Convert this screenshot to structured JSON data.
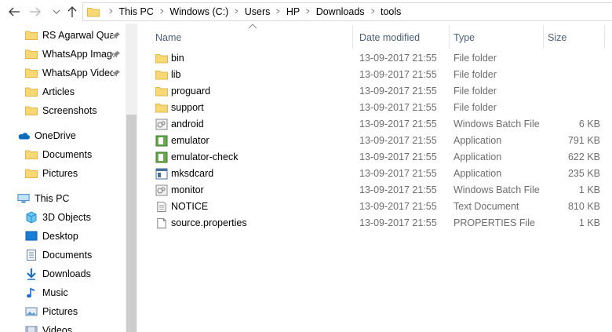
{
  "breadcrumb": [
    "This PC",
    "Windows (C:)",
    "Users",
    "HP",
    "Downloads",
    "tools"
  ],
  "sidebar": {
    "quick_access": [
      {
        "label": "RS Agarwal Quan",
        "pinned": true
      },
      {
        "label": "WhatsApp Image",
        "pinned": true
      },
      {
        "label": "WhatsApp Video",
        "pinned": true
      },
      {
        "label": "Articles",
        "pinned": false
      },
      {
        "label": "Screenshots",
        "pinned": false
      }
    ],
    "onedrive": {
      "label": "OneDrive",
      "items": [
        "Documents",
        "Pictures"
      ]
    },
    "this_pc": {
      "label": "This PC",
      "items": [
        "3D Objects",
        "Desktop",
        "Documents",
        "Downloads",
        "Music",
        "Pictures",
        "Videos"
      ]
    }
  },
  "columns": {
    "name": "Name",
    "date": "Date modified",
    "type": "Type",
    "size": "Size"
  },
  "files": [
    {
      "name": "bin",
      "date": "13-09-2017 21:55",
      "type": "File folder",
      "size": "",
      "icon": "folder-icon"
    },
    {
      "name": "lib",
      "date": "13-09-2017 21:55",
      "type": "File folder",
      "size": "",
      "icon": "folder-icon"
    },
    {
      "name": "proguard",
      "date": "13-09-2017 21:55",
      "type": "File folder",
      "size": "",
      "icon": "folder-icon"
    },
    {
      "name": "support",
      "date": "13-09-2017 21:55",
      "type": "File folder",
      "size": "",
      "icon": "folder-icon"
    },
    {
      "name": "android",
      "date": "13-09-2017 21:55",
      "type": "Windows Batch File",
      "size": "6 KB",
      "icon": "batch-file-icon"
    },
    {
      "name": "emulator",
      "date": "13-09-2017 21:55",
      "type": "Application",
      "size": "791 KB",
      "icon": "application-icon"
    },
    {
      "name": "emulator-check",
      "date": "13-09-2017 21:55",
      "type": "Application",
      "size": "622 KB",
      "icon": "application-icon"
    },
    {
      "name": "mksdcard",
      "date": "13-09-2017 21:55",
      "type": "Application",
      "size": "235 KB",
      "icon": "app-window-icon"
    },
    {
      "name": "monitor",
      "date": "13-09-2017 21:55",
      "type": "Windows Batch File",
      "size": "1 KB",
      "icon": "batch-file-icon"
    },
    {
      "name": "NOTICE",
      "date": "13-09-2017 21:55",
      "type": "Text Document",
      "size": "810 KB",
      "icon": "text-file-icon"
    },
    {
      "name": "source.properties",
      "date": "13-09-2017 21:55",
      "type": "PROPERTIES File",
      "size": "1 KB",
      "icon": "blank-file-icon"
    }
  ],
  "colors": {
    "folder": "#f8d775",
    "header_text": "#4c607a",
    "detail_text": "#6d6d6d",
    "onedrive": "#0f6cbd"
  }
}
